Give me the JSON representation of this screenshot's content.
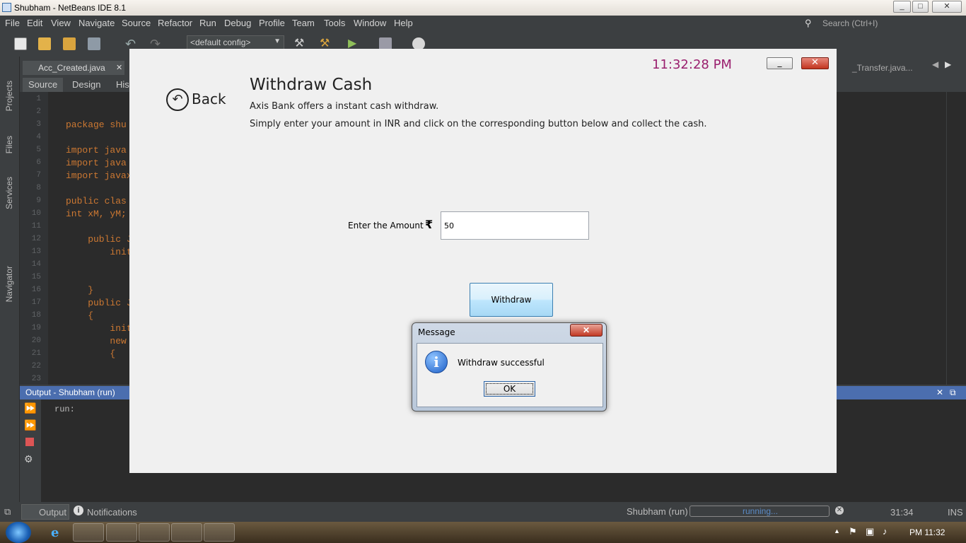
{
  "window": {
    "title": "Shubham - NetBeans IDE 8.1",
    "min": "_",
    "max": "□",
    "close": "✕"
  },
  "menu": [
    "File",
    "Edit",
    "View",
    "Navigate",
    "Source",
    "Refactor",
    "Run",
    "Debug",
    "Profile",
    "Team",
    "Tools",
    "Window",
    "Help"
  ],
  "search": {
    "placeholder": "Search (Ctrl+I)"
  },
  "toolbar": {
    "config": "<default config>"
  },
  "left_tabs": [
    "Projects",
    "Files",
    "Services",
    "Navigator"
  ],
  "editor": {
    "tabs": [
      "Acc_Created.java",
      "_Transfer.java..."
    ],
    "sub_tabs": [
      "Source",
      "Design",
      "His"
    ],
    "line_numbers": [
      "1",
      "2",
      "3",
      "4",
      "5",
      "6",
      "7",
      "8",
      "9",
      "10",
      "11",
      "12",
      "13",
      "14",
      "15",
      "16",
      "17",
      "18",
      "19",
      "20",
      "21",
      "22",
      "23"
    ],
    "code_lines": [
      "",
      "package shu",
      "",
      "import java",
      "import java",
      "import javax",
      "",
      "public clas",
      "int xM, yM;",
      "",
      "    public J",
      "        init",
      "",
      "",
      "    }",
      "    public J",
      "    {",
      "        init",
      "        new",
      "        {",
      "",
      "",
      ""
    ]
  },
  "output": {
    "title": "Output - Shubham (run)",
    "text": "run:"
  },
  "status": {
    "output_tab": "Output",
    "notifications_tab": "Notifications",
    "task": "Shubham (run)",
    "progress": "running...",
    "position": "31:34",
    "mode": "INS"
  },
  "taskbar": {
    "clock": "PM 11:32"
  },
  "app": {
    "clock": "11:32:28 PM",
    "min": "_",
    "close": "✕",
    "back_icon": "↶",
    "back": "Back",
    "title": "Withdraw Cash",
    "desc1": "Axis Bank offers a instant cash withdraw.",
    "desc2": "Simply enter your amount in INR and click on the corresponding button below and collect the cash.",
    "amount_label": "Enter the Amount",
    "currency": "₹",
    "amount_value": "50",
    "withdraw": "Withdraw"
  },
  "dialog": {
    "title": "Message",
    "close": "✕",
    "icon": "i",
    "message": "Withdraw successful",
    "ok": "OK"
  },
  "colors": {
    "clock": "#9a1f6e",
    "output_header": "#4b6eaf",
    "ide_bg": "#3c3f41",
    "editor_bg": "#2b2b2b",
    "keyword": "#cc7832"
  }
}
